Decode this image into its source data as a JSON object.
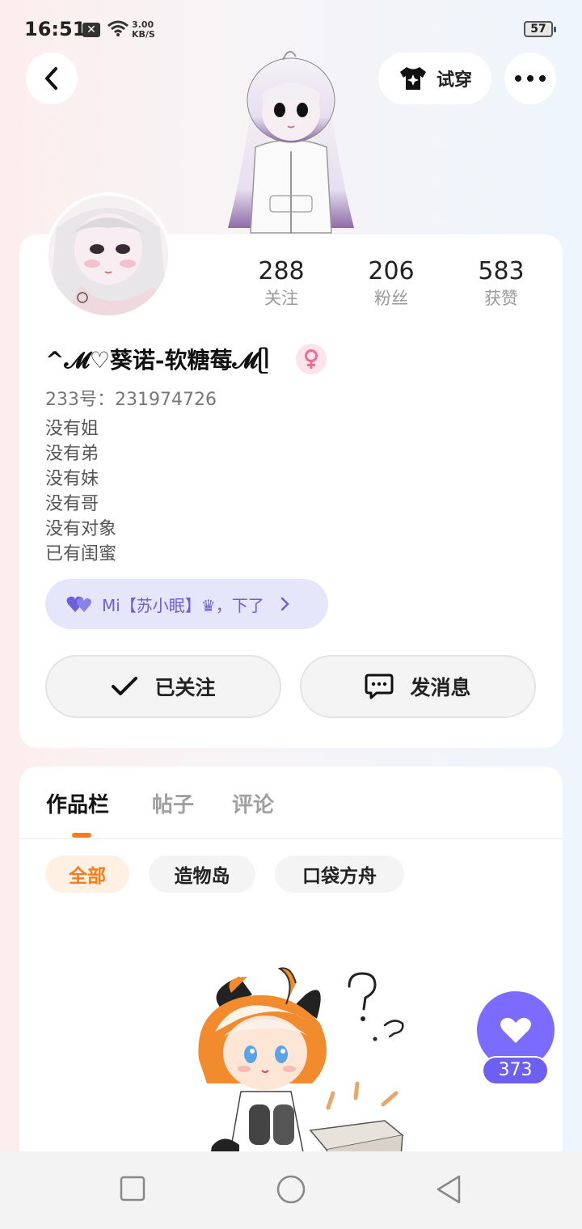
{
  "status_bar": {
    "time": "16:51",
    "notif_x": "✕",
    "net_speed_value": "3.00",
    "net_speed_unit": "KB/S",
    "battery": "57"
  },
  "header": {
    "back_icon": "chevron-left-icon",
    "tryon_icon": "tshirt-sparkle-icon",
    "tryon_label": "试穿",
    "more_icon": "more-dots-icon"
  },
  "profile": {
    "stats": [
      {
        "value": "288",
        "label": "关注"
      },
      {
        "value": "206",
        "label": "粉丝"
      },
      {
        "value": "583",
        "label": "获赞"
      }
    ],
    "username": "^𝓜♡葵诺-软糖莓𝓜ᥫ",
    "gender_icon": "female-icon",
    "gender_color": "#f06b93",
    "uid": "233号：231974726",
    "bio": [
      "没有姐",
      "没有弟",
      "没有妹",
      "没有哥",
      "没有对象",
      "已有闺蜜"
    ],
    "relation_pill": {
      "icon": "double-heart-icon",
      "text": "Mi【苏小眠】♛，下了",
      "chevron_icon": "chevron-right-icon",
      "color": "#6b60d9"
    },
    "follow_button": {
      "icon": "check-icon",
      "label": "已关注"
    },
    "message_button": {
      "icon": "chat-bubble-icon",
      "label": "发消息"
    }
  },
  "works": {
    "tabs": [
      "作品栏",
      "帖子",
      "评论"
    ],
    "active_tab": "作品栏",
    "filters": [
      "全部",
      "造物岛",
      "口袋方舟"
    ],
    "active_filter": "全部",
    "accent": "#ff7a1a"
  },
  "like_fab": {
    "icon": "heart-icon",
    "count": "373",
    "color": "#7b6bff"
  },
  "nav_bar": {
    "icons": [
      "square-recent-icon",
      "circle-home-icon",
      "triangle-back-icon"
    ]
  }
}
